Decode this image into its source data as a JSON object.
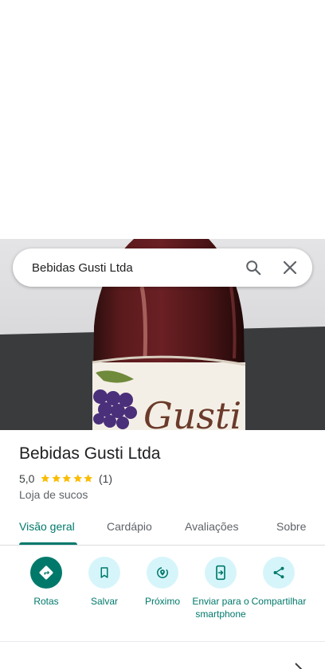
{
  "search": {
    "query": "Bebidas Gusti Ltda"
  },
  "hero": {
    "label_text": "Gusti"
  },
  "place": {
    "name": "Bebidas Gusti Ltda",
    "rating": "5,0",
    "rating_value": 5,
    "review_count": "(1)",
    "category": "Loja de sucos"
  },
  "tabs": [
    {
      "label": "Visão geral",
      "active": true
    },
    {
      "label": "Cardápio"
    },
    {
      "label": "Avaliações"
    },
    {
      "label": "Sobre"
    }
  ],
  "actions": [
    {
      "label": "Rotas",
      "icon": "directions-icon"
    },
    {
      "label": "Salvar",
      "icon": "bookmark-icon"
    },
    {
      "label": "Próximo",
      "icon": "nearby-icon"
    },
    {
      "label": "Enviar para o smartphone",
      "icon": "send-to-phone-icon"
    },
    {
      "label": "Compartilhar",
      "icon": "share-icon"
    }
  ],
  "colors": {
    "accent": "#00796b",
    "action_bg": "#d6f5fa",
    "star": "#fbbc04"
  }
}
